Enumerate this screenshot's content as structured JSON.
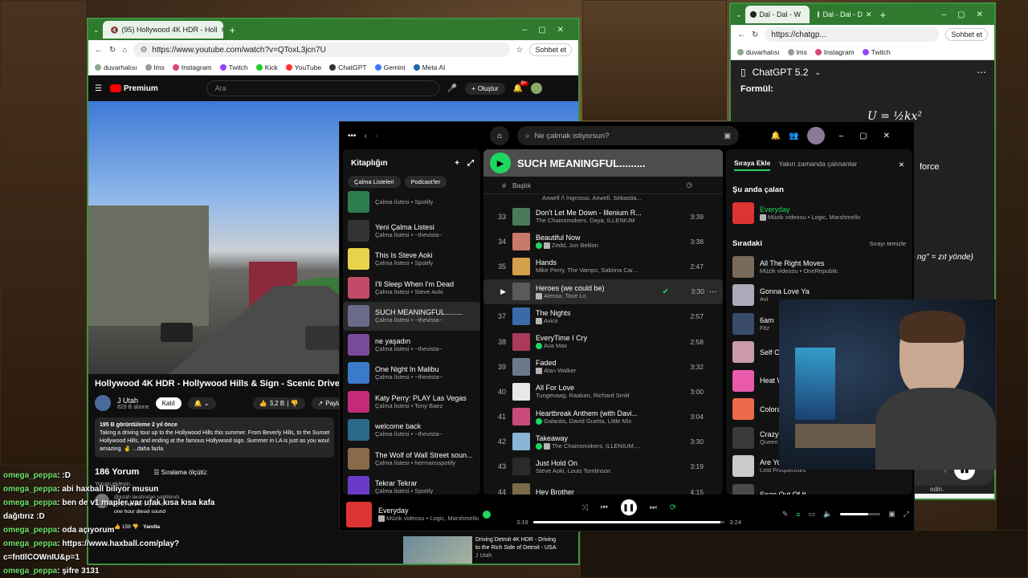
{
  "youtube_window": {
    "tab_title": "(95) Hollywood 4K HDR - Holl",
    "url": "https://www.youtube.com/watch?v=QToxL3jcn7U",
    "sohbet": "Sohbet et",
    "bookmarks": [
      "duvarhalısı",
      "lms",
      "Instagram",
      "Twitch",
      "Kick",
      "YouTube",
      "ChatGPT",
      "Gemini",
      "Meta AI"
    ],
    "premium": "Premium",
    "search_placeholder": "Ara",
    "create": "Oluştur",
    "notif_count": "9+",
    "video_title": "Hollywood 4K HDR - Hollywood Hills & Sign - Scenic Drive",
    "channel": "J Utah",
    "subscribers": "829 B abone",
    "join": "Katıl",
    "likes": "3,2 B",
    "share": "Paylaş",
    "views": "195 B görüntüleme  2 yıl önce",
    "desc1": "Taking a driving tour up to the Hollywood Hills this summer.  From Beverly Hills, to the Sunset Str",
    "desc2": "Hollywood Hills, and ending at the famous Hollywood sign.  Summer in LA is just as you would ex",
    "desc3": "amazing.  ✌  ...daha fazla",
    "comments_count": "186 Yorum",
    "sort": "Sıralama ölçütü:",
    "comment_placeholder": "Yorum ekleyin...",
    "pinned_by": "@jutah tarafından sabitlendi",
    "commenter": "@N_Archer",
    "comment_time": "2 yıl önce",
    "comment_text": "one hour diesel sound",
    "comment_likes": "159",
    "reply": "Yanıtla",
    "rec_title1": "Driving Detroit 4K HDR - Driving",
    "rec_title2": "to the Rich Side of Detroit - USA",
    "rec_channel": "J Utah"
  },
  "chatgpt_window": {
    "tab1": "Dal - Dal - W",
    "tab2": "Dal - Dal - D",
    "url": "https://chatgp...",
    "sohbet": "Sohbet et",
    "bookmarks": [
      "duvarhalısı",
      "lms",
      "Instagram",
      "Twitch"
    ],
    "title": "ChatGPT 5.2",
    "formul": "Formül:",
    "formula": "U = ½kx²",
    "force": "force",
    "zit": "ng\" = zıt yönde)",
    "edin": "edin."
  },
  "spotify": {
    "search_placeholder": "Ne çalmak istiyorsun?",
    "library_title": "Kitaplığın",
    "filters": [
      "Çalma Listeleri",
      "Podcast'ler"
    ],
    "library": [
      {
        "title": "",
        "sub": "Çalma listesi • Spotify",
        "color": "#2e7d4f"
      },
      {
        "title": "Yeni Çalma Listesi",
        "sub": "Çalma listesi • ~thevista~",
        "color": "#333333"
      },
      {
        "title": "This Is Steve Aoki",
        "sub": "Çalma listesi • Spotify",
        "color": "#e8d34a"
      },
      {
        "title": "I'll Sleep When I'm Dead",
        "sub": "Çalma listesi • Steve Aoki",
        "color": "#c44a6a"
      },
      {
        "title": "SUCH MEANINGFUL.........",
        "sub": "Çalma listesi • ~thevista~",
        "color": "#6a6a8a"
      },
      {
        "title": "ne yaşadın",
        "sub": "Çalma listesi • ~thevista~",
        "color": "#7a4a9a"
      },
      {
        "title": "One Night In Malibu",
        "sub": "Çalma listesi • ~thevista~",
        "color": "#3a7aca"
      },
      {
        "title": "Katy Perry: PLAY Las Vegas",
        "sub": "Çalma listesi • Tony Baez",
        "color": "#c42a7a"
      },
      {
        "title": "welcome back",
        "sub": "Çalma listesi • ~thevista~",
        "color": "#2a6a8a"
      },
      {
        "title": "The Wolf of Wall Street soun...",
        "sub": "Çalma listesi • hermansspotify",
        "color": "#8a6a4a"
      },
      {
        "title": "Tekrar Tekrar",
        "sub": "Çalma listesi • Spotify",
        "color": "#6a3aca"
      }
    ],
    "playlist_title": "SUCH MEANINGFUL.........",
    "col_title": "Başlık",
    "partial_top": "Axwell /\\ Ingrosso, Axwell, Sebastia...",
    "tracks": [
      {
        "num": "33",
        "title": "Don't Let Me Down - Illenium R...",
        "artist": "The Chainsmokers, Daya, ILLENIUM",
        "dur": "3:39",
        "color": "#4a7a5a",
        "badge": "none"
      },
      {
        "num": "34",
        "title": "Beautiful Now",
        "artist": "Zedd, Jon Bellion",
        "dur": "3:38",
        "color": "#c97a6a",
        "badge": "both"
      },
      {
        "num": "35",
        "title": "Hands",
        "artist": "Mike Perry, The Vamps, Sabrina Car...",
        "dur": "2:47",
        "color": "#d4a04a",
        "badge": "none"
      },
      {
        "num": "",
        "title": "Heroes (we could be)",
        "artist": "Alesso, Tove Lo",
        "dur": "3:30",
        "color": "#5a5a5a",
        "badge": "explicit"
      },
      {
        "num": "37",
        "title": "The Nights",
        "artist": "Avicii",
        "dur": "2:57",
        "color": "#3a6aaa",
        "badge": "explicit"
      },
      {
        "num": "38",
        "title": "EveryTime I Cry",
        "artist": "Ava Max",
        "dur": "2:58",
        "color": "#aa3a5a",
        "badge": "green"
      },
      {
        "num": "39",
        "title": "Faded",
        "artist": "Alan Walker",
        "dur": "3:32",
        "color": "#6a7a8a",
        "badge": "explicit"
      },
      {
        "num": "40",
        "title": "All For Love",
        "artist": "Tungevaag, Raaban, Richard Smitt",
        "dur": "3:00",
        "color": "#e8e8e8",
        "badge": "none"
      },
      {
        "num": "41",
        "title": "Heartbreak Anthem (with Davi...",
        "artist": "Galantis, David Guetta, Little Mix",
        "dur": "3:04",
        "color": "#ca4a7a",
        "badge": "green"
      },
      {
        "num": "42",
        "title": "Takeaway",
        "artist": "The Chainsmokers, ILLENIUM,...",
        "dur": "3:30",
        "color": "#8ab4d4",
        "badge": "both"
      },
      {
        "num": "43",
        "title": "Just Hold On",
        "artist": "Steve Aoki, Louis Tomlinson",
        "dur": "3:19",
        "color": "#2a2a2a",
        "badge": "none"
      },
      {
        "num": "44",
        "title": "Hey Brother",
        "artist": "",
        "dur": "4:15",
        "color": "#7a6a4a",
        "badge": "none"
      }
    ],
    "queue_tabs": [
      "Sıraya Ekle",
      "Yakın zamanda çalınanlar"
    ],
    "now_playing_label": "Şu anda çalan",
    "now_title": "Everyday",
    "now_sub": "Müzik videosu • Logic, Marshmello",
    "next_label": "Sıradaki",
    "clear_queue": "Sırayı temizle",
    "queue": [
      {
        "title": "All The Right Moves",
        "sub": "Müzik videosu • OneRepublic",
        "color": "#7a6a5a"
      },
      {
        "title": "Gonna Love Ya",
        "sub": "Avi",
        "color": "#aaaaba"
      },
      {
        "title": "6am",
        "sub": "Fitz",
        "color": "#3a4a6a"
      },
      {
        "title": "Self C",
        "sub": "",
        "color": "#ca9aaa"
      },
      {
        "title": "Heat W",
        "sub": "",
        "color": "#ea5aaa"
      },
      {
        "title": "Colora",
        "sub": "",
        "color": "#ea6a4a"
      },
      {
        "title": "Crazy",
        "sub": "Queen",
        "color": "#3a3a3a"
      },
      {
        "title": "Are You With Me - Radio Edit",
        "sub": "Lost Frequencies",
        "color": "#cacaca"
      },
      {
        "title": "Snap Out Of It",
        "sub": "",
        "color": "#4a4a4a"
      }
    ],
    "player_title": "Everyday",
    "player_sub": "Müzik videosu • Logic, Marshmello",
    "elapsed": "3:19",
    "total": "3:24",
    "progress": 0.976
  },
  "chat": [
    {
      "name": "omega_peppa",
      "text": ": :D"
    },
    {
      "name": "omega_peppa",
      "text": ": abi haxball biliyor musun"
    },
    {
      "name": "omega_peppa",
      "text": ": ben de v1 mapler var ufak kısa kısa kafa"
    },
    {
      "name": "",
      "text": "dağıtırız :D"
    },
    {
      "name": "omega_peppa",
      "text": ": oda açıyorum"
    },
    {
      "name": "omega_peppa",
      "text": ": https://www.haxball.com/play?"
    },
    {
      "name": "",
      "text": "c=fntIlCOWnIU&p=1"
    },
    {
      "name": "omega_peppa",
      "text": ": şifre 3131"
    }
  ]
}
